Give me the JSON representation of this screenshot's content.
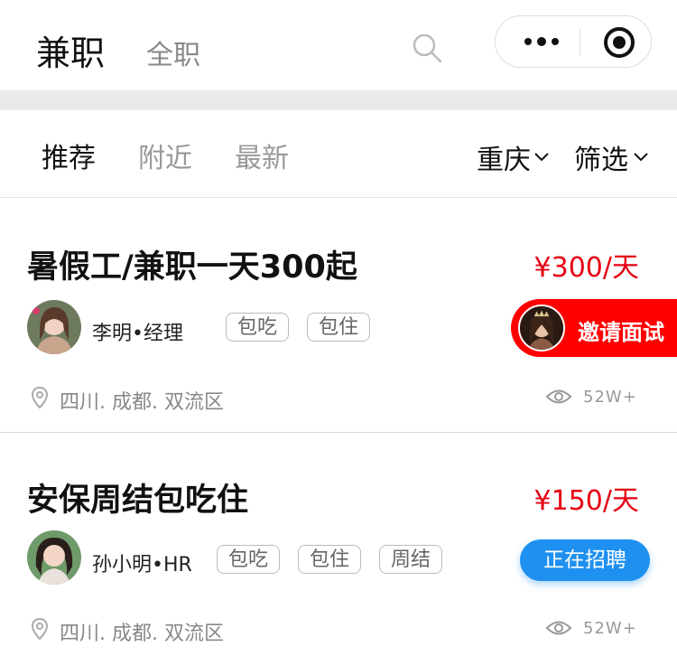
{
  "header": {
    "tabs": [
      {
        "label": "兼职",
        "active": true
      },
      {
        "label": "全职",
        "active": false
      }
    ],
    "search_icon": "search-icon",
    "capsule": {
      "more_icon": "more-dots-icon",
      "close_icon": "target-icon"
    }
  },
  "filters": {
    "tabs": [
      {
        "label": "推荐",
        "active": true
      },
      {
        "label": "附近",
        "active": false
      },
      {
        "label": "最新",
        "active": false
      }
    ],
    "city": "重庆",
    "filter_label": "筛选"
  },
  "jobs": [
    {
      "title": "暑假工/兼职一天300起",
      "price": "¥300/天",
      "poster": "李明•经理",
      "tags": [
        "包吃",
        "包住"
      ],
      "location": "四川. 成都. 双流区",
      "views": "52W+",
      "action": "邀请面试",
      "action_color": "#ff0000"
    },
    {
      "title": "安保周结包吃住",
      "price": "¥150/天",
      "poster": "孙小明•HR",
      "tags": [
        "包吃",
        "包住",
        "周结"
      ],
      "location": "四川. 成都. 双流区",
      "views": "52W+",
      "action": "正在招聘",
      "action_color": "#1e90f0"
    }
  ],
  "colors": {
    "price": "#e60012",
    "accent_blue": "#1e90f0",
    "accent_red": "#ff0000"
  }
}
